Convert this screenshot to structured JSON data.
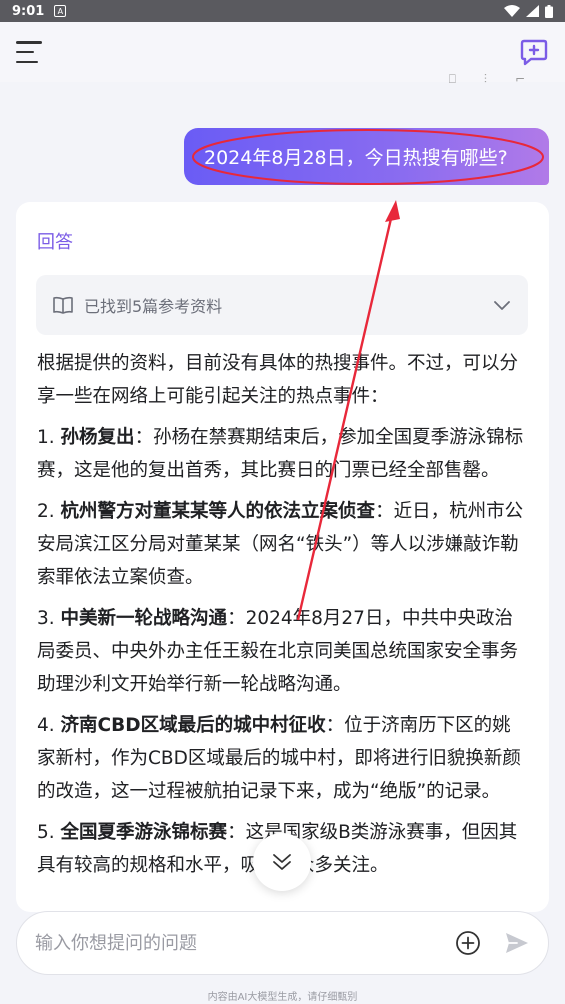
{
  "status_bar": {
    "time": "9:01",
    "notif_glyph": "A"
  },
  "chat": {
    "user_message": "2024年8月28日，今日热搜有哪些?",
    "answer_label": "回答",
    "refs_label": "已找到5篇参考资料",
    "intro": "根据提供的资料，目前没有具体的热搜事件。不过，可以分享一些在网络上可能引起关注的热点事件：",
    "items": [
      {
        "num": "1. ",
        "title": "孙杨复出",
        "text": "：孙杨在禁赛期结束后，参加全国夏季游泳锦标赛，这是他的复出首秀，其比赛日的门票已经全部售罄。"
      },
      {
        "num": "2. ",
        "title": "杭州警方对董某某等人的依法立案侦查",
        "text": "：近日，杭州市公安局滨江区分局对董某某（网名“铁头”）等人以涉嫌敲诈勒索罪依法立案侦查。"
      },
      {
        "num": "3. ",
        "title": "中美新一轮战略沟通",
        "text": "：2024年8月27日，中共中央政治局委员、中央外办主任王毅在北京同美国总统国家安全事务助理沙利文开始举行新一轮战略沟通。"
      },
      {
        "num": "4. ",
        "title": "济南CBD区域最后的城中村征收",
        "text": "：位于济南历下区的姚家新村，作为CBD区域最后的城中村，即将进行旧貌换新颜的改造，这一过程被航拍记录下来，成为“绝版”的记录。"
      },
      {
        "num": "5. ",
        "title": "全国夏季游泳锦标赛",
        "text": "：这是国家级B类游泳赛事，但因其具有较高的规格和水平，吸引了众多关注。"
      }
    ]
  },
  "input": {
    "placeholder": "输入你想提问的问题"
  },
  "footer": {
    "disclaimer": "内容由AI大模型生成，请仔细甄别"
  },
  "colors": {
    "accent": "#7b5ce6",
    "annotation": "#e8283a"
  }
}
